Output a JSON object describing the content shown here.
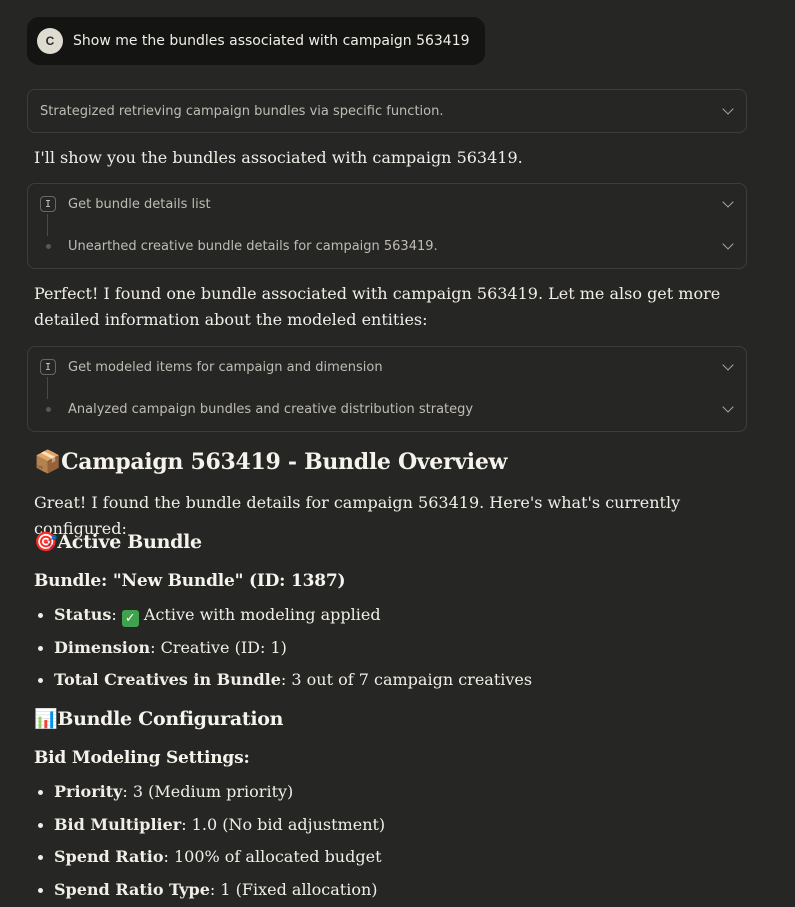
{
  "user_message": {
    "avatar_letter": "C",
    "text": "Show me the bundles associated with campaign 563419"
  },
  "thinking": {
    "summary": "Strategized retrieving campaign bundles via specific function."
  },
  "intro_text": "I'll show you the bundles associated with campaign 563419.",
  "tool_call_1": {
    "icon_glyph": "I",
    "title": "Get bundle details list",
    "result": "Unearthed creative bundle details for campaign 563419."
  },
  "followup_text": "Perfect! I found one bundle associated with campaign 563419. Let me also get more detailed information about the modeled entities:",
  "tool_call_2": {
    "icon_glyph": "I",
    "title": "Get modeled items for campaign and dimension",
    "result": "Analyzed campaign bundles and creative distribution strategy"
  },
  "overview": {
    "emoji": "📦",
    "title": "Campaign 563419 - Bundle Overview",
    "intro": "Great! I found the bundle details for campaign 563419. Here's what's currently configured:"
  },
  "active_bundle": {
    "emoji": "🎯",
    "heading": "Active Bundle",
    "bundle_line": "Bundle: \"New Bundle\" (ID: 1387)",
    "items": [
      {
        "label": "Status",
        "check": "✓",
        "value": " Active with modeling applied"
      },
      {
        "label": "Dimension",
        "value": ": Creative (ID: 1)"
      },
      {
        "label": "Total Creatives in Bundle",
        "value": ": 3 out of 7 campaign creatives"
      }
    ]
  },
  "configuration": {
    "emoji": "📊",
    "heading": "Bundle Configuration",
    "subheading": "Bid Modeling Settings:",
    "items": [
      {
        "label": "Priority",
        "value": ": 3 (Medium priority)"
      },
      {
        "label": "Bid Multiplier",
        "value": ": 1.0 (No bid adjustment)"
      },
      {
        "label": "Spend Ratio",
        "value": ": 100% of allocated budget"
      },
      {
        "label": "Spend Ratio Type",
        "value": ": 1 (Fixed allocation)"
      }
    ]
  }
}
